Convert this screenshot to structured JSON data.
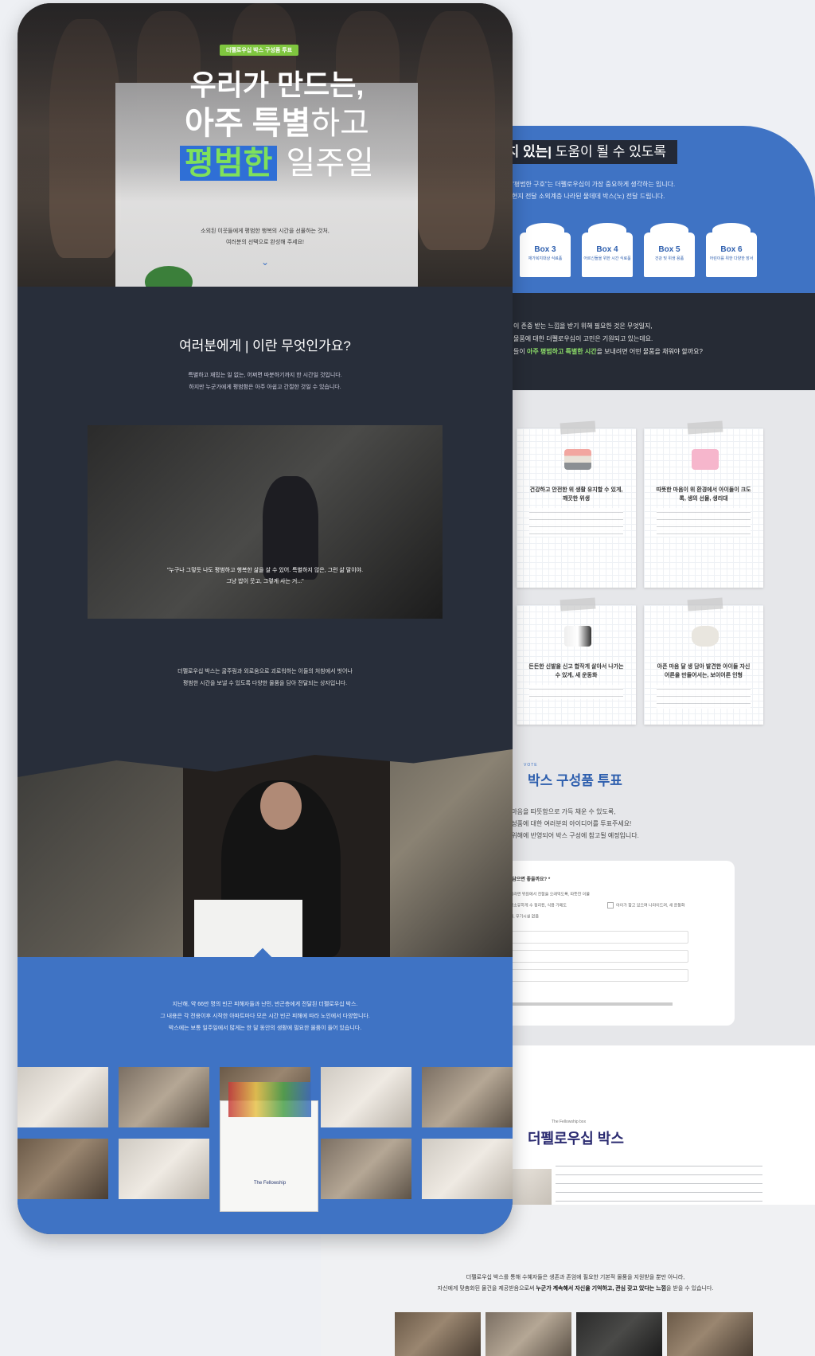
{
  "hero": {
    "badge": "더펠로우십 박스 구성품 투표",
    "title_line1": "우리가 만드는,",
    "title_line2_bold": "아주 특별",
    "title_line2_rest": "하고",
    "title_line3_highlight": "평범한",
    "title_line3_rest": " 일주일",
    "subtitle_line1": "소외된 이웃들에게 평범한 행복의 시간을 선물하는 것처,",
    "subtitle_line2": "여러분의 선택으로 완성해 주세요!",
    "arrow": "⌄"
  },
  "intro": {
    "question": "여러분에게 | 이란 무엇인가요?",
    "text_line1": "특별하고 재밌는 일 없는, 어쩌면 따분하기까지 한 시간일 것입니다.",
    "text_line2": "하지만 누군가에게 평범함은 아주 아쉽고 간절한 것일 수 있습니다.",
    "quote_line1": "\"누구나 그렇듯 나도 평범하고 행복한 삶을 살 수 있어. 특별하지 않은, 그런 삶 말이야.",
    "quote_line2": "그냥 밥이 웃고, 그렇게 사는 거...\"",
    "desc_line1": "더펠로우십 박스는 굶주림과 외로움으로 괴로워하는 이들의 처참에서 벗어나",
    "desc_line2": "평범한 시간을 보낼 수 있도록 다양한 물품을 담아 전달되는 상자입니다."
  },
  "impact": {
    "line1": "지난해, 약 66만 명의 빈곤 피해자들과 난민, 반곤층에게 전달된 더펠로우십 박스.",
    "line2": "그 내용은 각 전용이후 시작한 아파트마다 모은 시간 빈곤 피해에 따라 노인에서 다양합니다.",
    "line3": "박스에는 보통 일주일에서 많게는 한 달 동안의 생활에 필요한 물품이 들어 있습니다.",
    "box_label": "The Fellowship"
  },
  "back": {
    "headline_bold": "가치 있는|",
    "headline_rest": " 도움이 될 수 있도록",
    "sub_line1": "\"평범한 구호\"는 더펠로우십이 가장 중요하게 생각하는 입니다.",
    "sub_line2": "현지 전달 소외계층 나라된 물데데 박스(노) 전달 드립니다.",
    "boxes": [
      {
        "num": "Box 3",
        "caption": "재가복지대상 식료품"
      },
      {
        "num": "Box 4",
        "caption": "어르신들을 위한 시간 식료품"
      },
      {
        "num": "Box 5",
        "caption": "건강 및 위생 용품"
      },
      {
        "num": "Box 6",
        "caption": "어린이를 위한 다양한 장서"
      }
    ],
    "dark_line1": "이 존중 받는 느낌을 받기 위해 필요한 것은 무엇일지,",
    "dark_line2": "물품에 대한 더펠로우십이 고민은 기원되고 있는데요.",
    "dark_line3_pre": "들이 ",
    "dark_line3_hl": "아주 평범하고 특별한 시간",
    "dark_line3_post": "을 보내려면 어떤 물품을 채워야 할까요?",
    "notes": [
      {
        "title": "건강하고 안전한 위 생활 유지할 수 있게, 깨끗한 위생"
      },
      {
        "title": "따뜻한 마음이 위 환경에서 아이들이 크도록, 생의 선물, 생리대"
      },
      {
        "title": "든든한 신발을 신고 합작게 살아서 나가는 수 있게, 새 운동화"
      },
      {
        "title": "아픈 마음 달 생 담아 발견한 아이들 자신 어른을 만들어서는, 보이어른 인형"
      }
    ],
    "vote_small": "VOTE",
    "vote_title": "박스 구성품 투표",
    "vote_line1": "• 이웃의 마음을 따뜻함으로 가득 채운 수 있도록,",
    "vote_line2": "• 박스 구성품에 대한 여러분의 아이디어를 투표주세요!",
    "vote_line3": "• 결과는 위해에 반영되어 박스 구성에 참고될 예정입니다.",
    "form_question": "구호를 담으면 좋을까요? *",
    "form_options": [
      "나눠라면 위원에서 전함을 오래먹도록, 따뜻한 이불",
      "가정소유하게 수 정리된, 식용 가메도",
      "아이가 합고 있으며 나라이드려, 새 운동화",
      "기타, 무기시설 없음"
    ],
    "fellowship_small": "The Fellowship box",
    "fellowship_title": "더펠로우십 박스",
    "bottom_line1": "더펠로우십 박스를 통해 수혜자들은 생존과 존엄에 필요한 기본적 물품을 지원받을 뿐만 아니라,",
    "bottom_line2_pre": "자신에게 맞춤화된 물건을 제공받음으로써 ",
    "bottom_line2_bold": "누군가 계속해서 자신을 기억하고, 관심 갖고 있다는 느낌",
    "bottom_line2_post": "을 받을 수 있습니다."
  },
  "colors": {
    "brand_blue": "#3f73c4",
    "dark_navy": "#282e3a",
    "accent_green": "#7fc63f"
  }
}
